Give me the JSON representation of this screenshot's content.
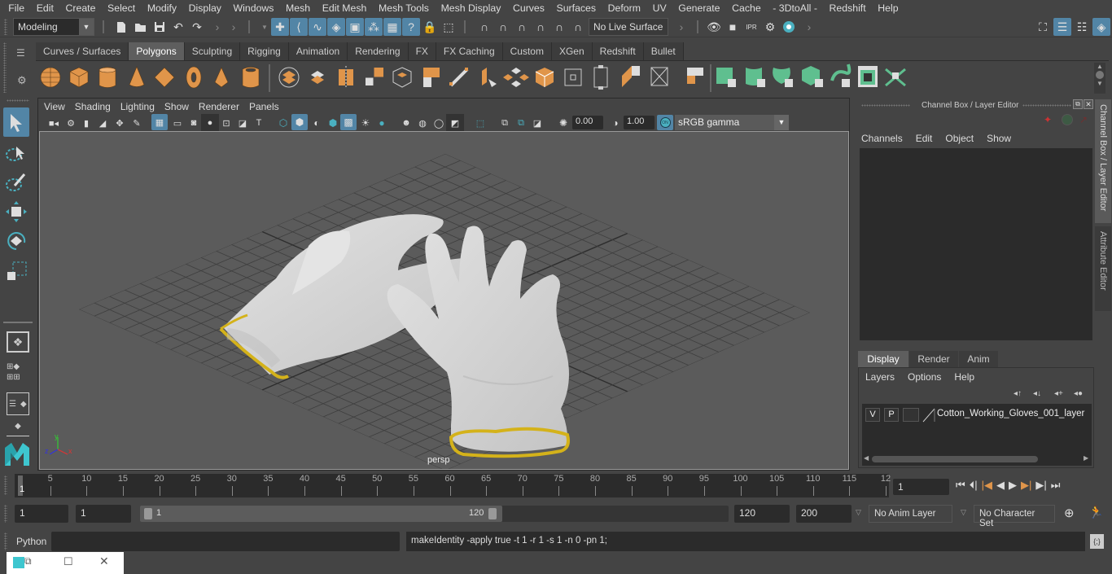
{
  "menubar": [
    "File",
    "Edit",
    "Create",
    "Select",
    "Modify",
    "Display",
    "Windows",
    "Mesh",
    "Edit Mesh",
    "Mesh Tools",
    "Mesh Display",
    "Curves",
    "Surfaces",
    "Deform",
    "UV",
    "Generate",
    "Cache",
    "- 3DtoAll -",
    "Redshift",
    "Help"
  ],
  "statusline": {
    "mode": "Modeling",
    "live_surface": "No Live Surface"
  },
  "shelf": {
    "tabs": [
      "Curves / Surfaces",
      "Polygons",
      "Sculpting",
      "Rigging",
      "Animation",
      "Rendering",
      "FX",
      "FX Caching",
      "Custom",
      "XGen",
      "Redshift",
      "Bullet"
    ],
    "active_tab": "Polygons"
  },
  "viewport": {
    "menu": [
      "View",
      "Shading",
      "Lighting",
      "Show",
      "Renderer",
      "Panels"
    ],
    "exposure": "0.00",
    "gamma": "1.00",
    "color_mgmt_toggle": "ON",
    "color_space": "sRGB gamma",
    "camera_label": "persp",
    "axis": {
      "x": "x",
      "y": "y",
      "z": "z"
    }
  },
  "channel_box": {
    "title": "Channel Box / Layer Editor",
    "menu": [
      "Channels",
      "Edit",
      "Object",
      "Show"
    ]
  },
  "layer_editor": {
    "tabs": [
      "Display",
      "Render",
      "Anim"
    ],
    "active_tab": "Display",
    "menu": [
      "Layers",
      "Options",
      "Help"
    ],
    "layers": [
      {
        "visible": "V",
        "playback": "P",
        "name": "Cotton_Working_Gloves_001_layer"
      }
    ]
  },
  "side_tabs": [
    "Channel Box / Layer Editor",
    "Attribute Editor"
  ],
  "timeline": {
    "ticks": [
      5,
      10,
      15,
      20,
      25,
      30,
      35,
      40,
      45,
      50,
      55,
      60,
      65,
      70,
      75,
      80,
      85,
      90,
      95,
      100,
      105,
      110,
      115,
      "12"
    ],
    "current_frame_marker": "1",
    "current_frame": "1"
  },
  "range": {
    "start": "1",
    "playback_start": "1",
    "slider_start": "1",
    "slider_end": "120",
    "playback_end": "120",
    "end": "200",
    "anim_layer": "No Anim Layer",
    "character_set": "No Character Set"
  },
  "command": {
    "lang": "Python",
    "input": "",
    "result": "makeIdentity -apply true -t 1 -r 1 -s 1 -n 0 -pn 1;"
  },
  "colors": {
    "accent_blue": "#5285a6",
    "shelf_orange": "#e0954a",
    "shelf_green": "#5fbf8f",
    "glove_trim": "#d9b21a"
  }
}
